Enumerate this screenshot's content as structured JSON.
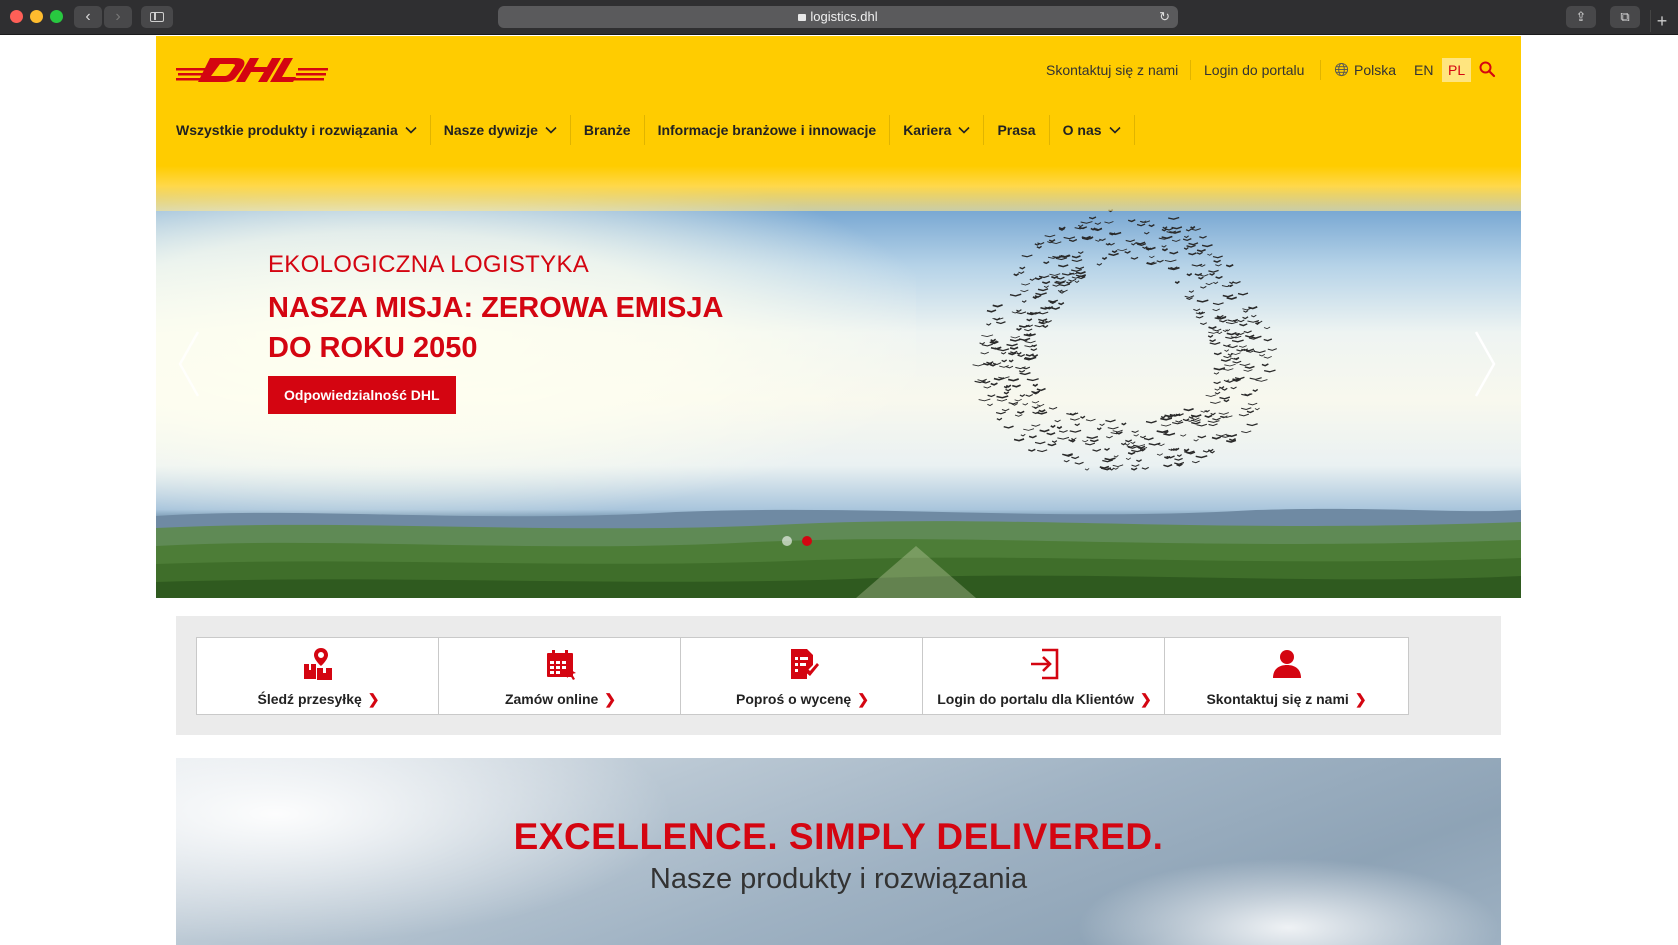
{
  "browser": {
    "url": "logistics.dhl",
    "back": "‹",
    "forward": "›",
    "reload": "↻",
    "share": "⇪",
    "tabs": "⧉",
    "new_tab": "+"
  },
  "header": {
    "logo_text": "DHL",
    "utility": {
      "contact": "Skontaktuj się z nami",
      "portal_login": "Login do portalu",
      "country": "Polska",
      "lang_en": "EN",
      "lang_pl": "PL"
    },
    "nav": [
      {
        "label": "Wszystkie produkty i rozwiązania",
        "dropdown": true
      },
      {
        "label": "Nasze dywizje",
        "dropdown": true
      },
      {
        "label": "Branże",
        "dropdown": false
      },
      {
        "label": "Informacje branżowe i innowacje",
        "dropdown": false
      },
      {
        "label": "Kariera",
        "dropdown": true
      },
      {
        "label": "Prasa",
        "dropdown": false
      },
      {
        "label": "O nas",
        "dropdown": true
      }
    ]
  },
  "hero": {
    "kicker": "EKOLOGICZNA LOGISTYKA",
    "title": "NASZA MISJA: ZEROWA EMISJA DO ROKU 2050",
    "button": "Odpowiedzialność DHL",
    "slides": 2,
    "active_slide": 2
  },
  "quick_links": [
    {
      "label": "Śledź przesyłkę",
      "icon": "track-package-icon"
    },
    {
      "label": "Zamów online",
      "icon": "calendar-order-icon"
    },
    {
      "label": "Poproś o wycenę",
      "icon": "quote-document-icon"
    },
    {
      "label": "Login do portalu dla Klientów",
      "icon": "login-icon"
    },
    {
      "label": "Skontaktuj się z nami",
      "icon": "person-icon"
    }
  ],
  "arrow_glyph": "❯",
  "excellence": {
    "title": "EXCELLENCE. SIMPLY DELIVERED.",
    "subtitle": "Nasze produkty i rozwiązania"
  },
  "colors": {
    "brand_yellow": "#ffcc00",
    "brand_red": "#d40511"
  }
}
